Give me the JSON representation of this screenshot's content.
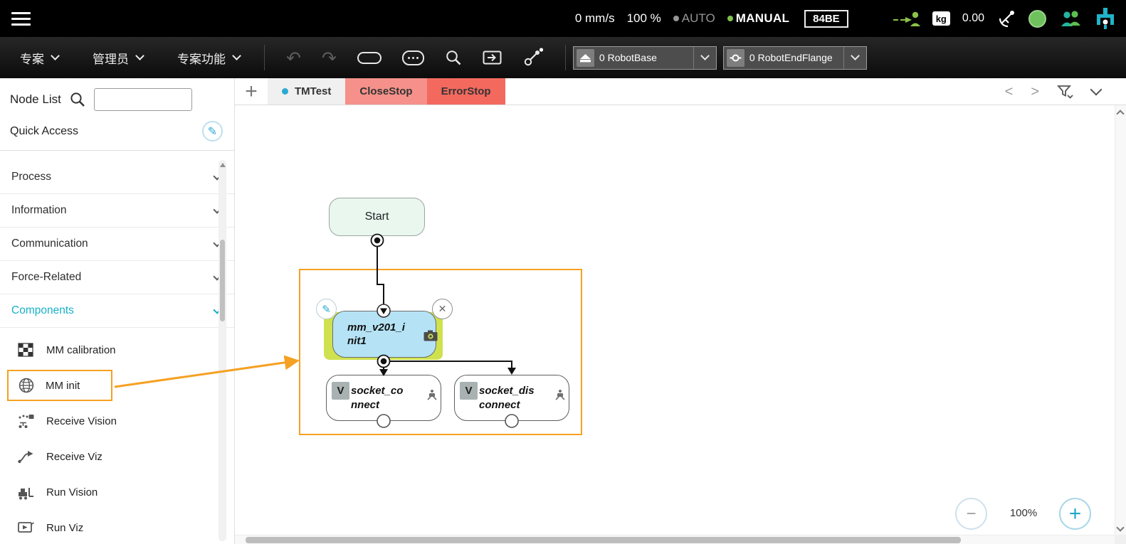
{
  "topbar": {
    "speed": "0 mm/s",
    "percent": "100 %",
    "auto": "AUTO",
    "manual": "MANUAL",
    "robot_id": "84BE",
    "kg": "kg",
    "payload": "0.00"
  },
  "toolbar": {
    "menus": [
      {
        "label": "专案"
      },
      {
        "label": "管理员"
      },
      {
        "label": "专案功能"
      }
    ],
    "base_dropdown": "0 RobotBase",
    "flange_dropdown": "0 RobotEndFlange"
  },
  "sidebar": {
    "title": "Node List",
    "search_value": "",
    "quick_access": "Quick Access",
    "sections": [
      {
        "label": "Process"
      },
      {
        "label": "Information"
      },
      {
        "label": "Communication"
      },
      {
        "label": "Force-Related"
      },
      {
        "label": "Components"
      }
    ],
    "components": [
      {
        "label": "MM calibration"
      },
      {
        "label": "MM init"
      },
      {
        "label": "Receive Vision"
      },
      {
        "label": "Receive Viz"
      },
      {
        "label": "Run Vision"
      },
      {
        "label": "Run Viz"
      }
    ]
  },
  "tabs": [
    {
      "label": "TMTest"
    },
    {
      "label": "CloseStop"
    },
    {
      "label": "ErrorStop"
    }
  ],
  "flow": {
    "start_label": "Start",
    "mm_node_label": "mm_v201_init1",
    "socket_connect_label": "socket_connect",
    "socket_disconnect_label": "socket_disconnect",
    "variable_badge": "V"
  },
  "zoom": {
    "level": "100%"
  },
  "icons": {
    "undo": "↶",
    "redo": "↷",
    "pencil": "✎",
    "close": "✕",
    "add_tab": "+",
    "prev": "<",
    "next": ">",
    "zoom_out": "−",
    "zoom_in": "+"
  },
  "colors": {
    "accent_cyan": "#18b0c8",
    "highlight_orange": "#f5a122",
    "closestop_bg": "#f5918a",
    "errorstop_bg": "#f4695e",
    "start_node_bg": "#e9f7ef",
    "mm_node_bg": "#b5e3f5",
    "mm_highlight_bg": "#cfe14f",
    "status_green": "#6fc15e"
  }
}
